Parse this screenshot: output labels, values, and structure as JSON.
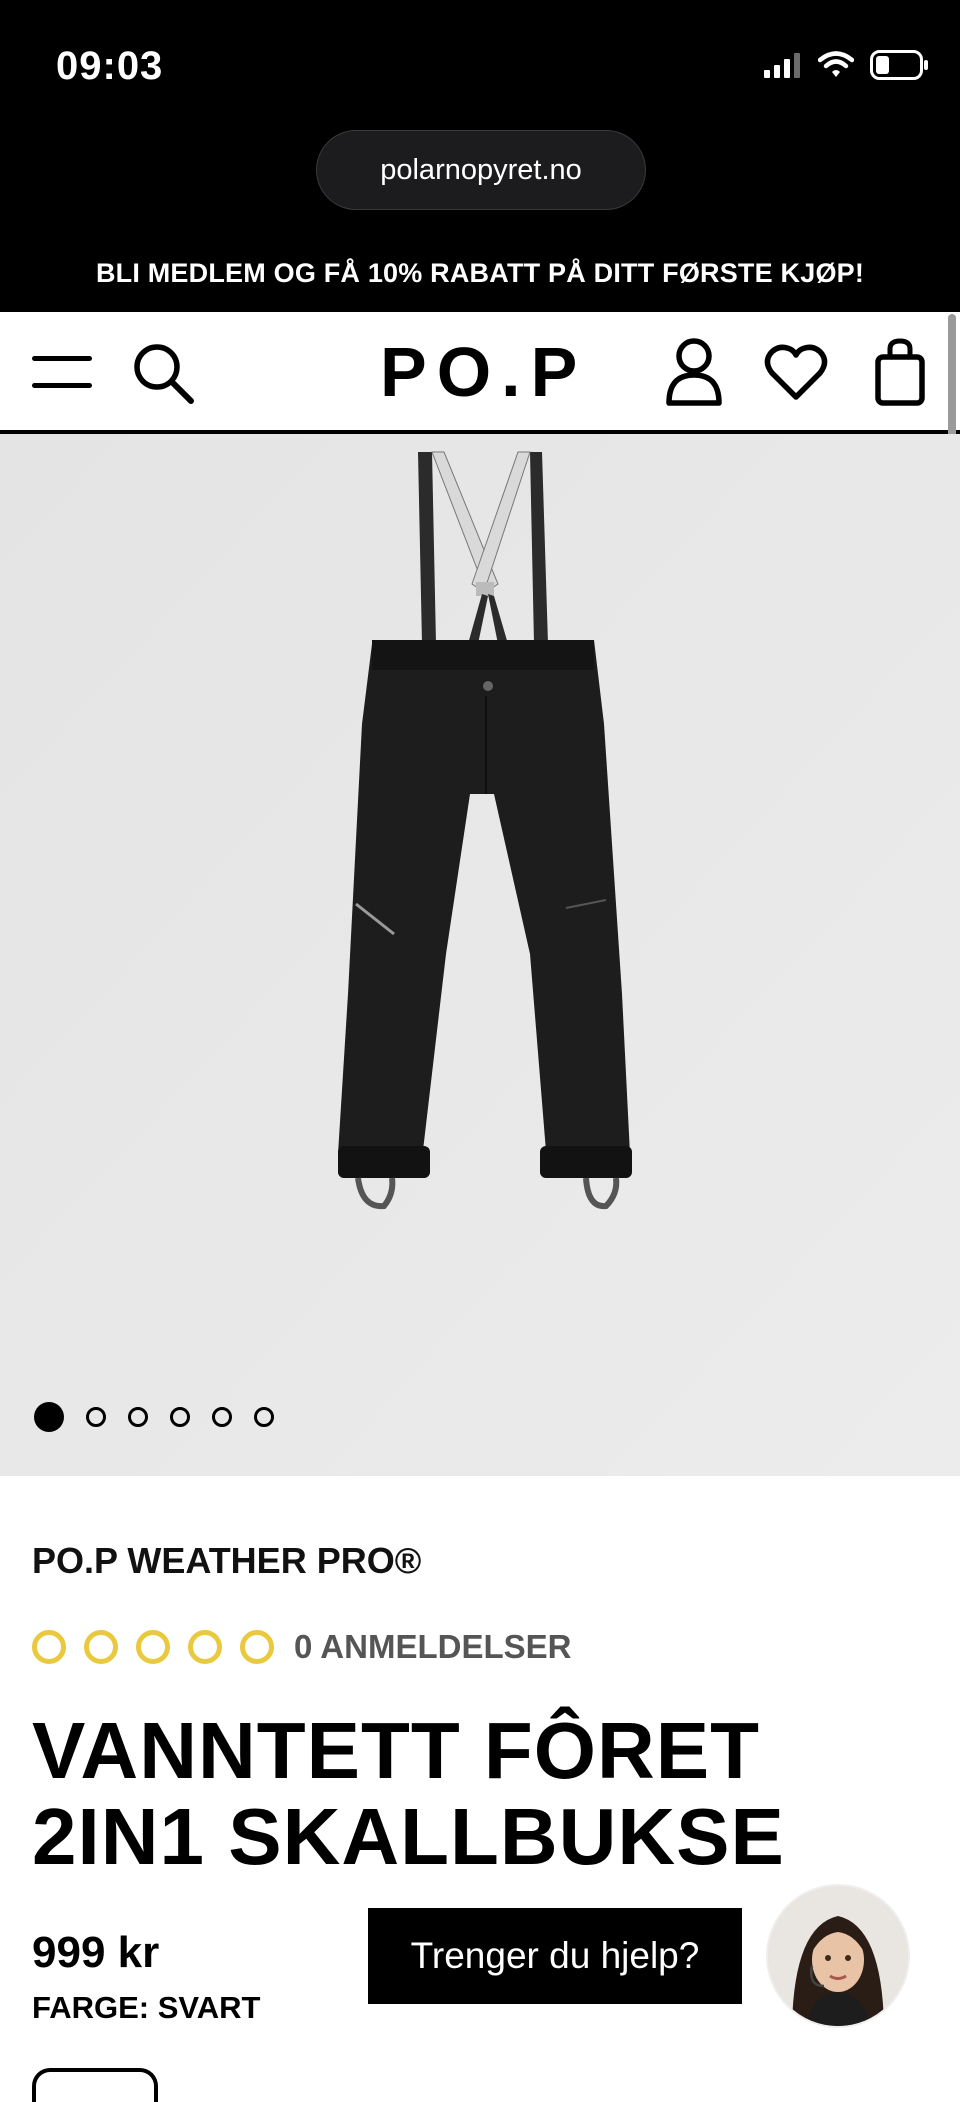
{
  "status_bar": {
    "time": "09:03",
    "icons": [
      "signal-icon",
      "wifi-icon",
      "battery-icon"
    ]
  },
  "browser": {
    "url": "polarnopyret.no"
  },
  "promo_banner": {
    "text": "BLI MEDLEM OG FÅ 10% RABATT PÅ DITT FØRSTE KJØP!"
  },
  "header": {
    "logo": "PO.P",
    "icons": [
      "menu-icon",
      "search-icon",
      "account-icon",
      "heart-icon",
      "bag-icon"
    ]
  },
  "gallery": {
    "image_count": 6,
    "active_index": 0
  },
  "product": {
    "brand_line": "PO.P WEATHER PRO®",
    "rating_stars": 0,
    "rating_max": 5,
    "reviews_label": "0 ANMELDELSER",
    "title": "VANNTETT FÔRET 2IN1 SKALLBUKSE",
    "price": "999 kr",
    "color_label": "FARGE: SVART"
  },
  "chat": {
    "help_label": "Trenger du hjelp?"
  },
  "colors": {
    "star": "#e9c93e",
    "banner_bg": "#000000",
    "image_bg": "#e6e6e6"
  }
}
